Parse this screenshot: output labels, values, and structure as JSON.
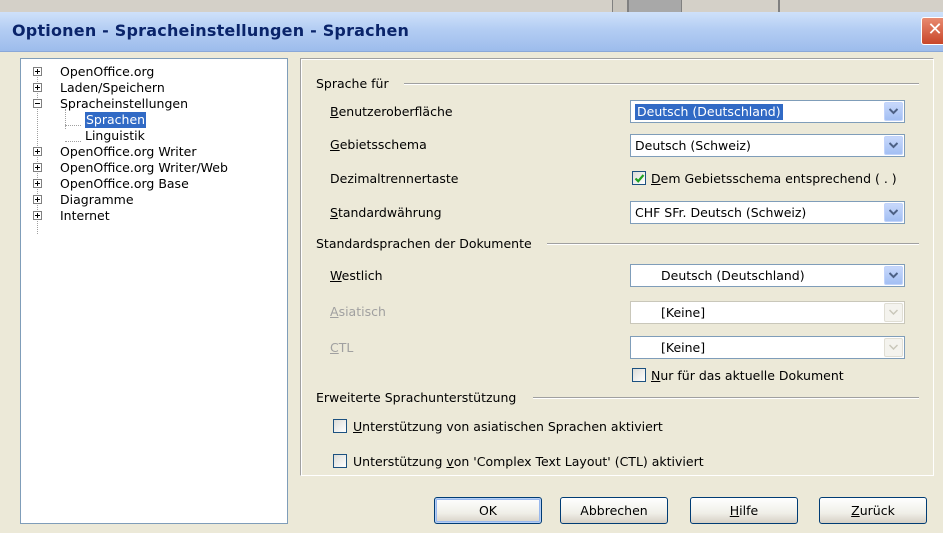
{
  "window": {
    "title": "Optionen - Spracheinstellungen - Sprachen",
    "close_glyph": "✕"
  },
  "tree": {
    "items": [
      {
        "label": "OpenOffice.org",
        "expander": "plus"
      },
      {
        "label": "Laden/Speichern",
        "expander": "plus"
      },
      {
        "label": "Spracheinstellungen",
        "expander": "minus"
      },
      {
        "label": "Sprachen",
        "selected": true,
        "child": true
      },
      {
        "label": "Linguistik",
        "child": true
      },
      {
        "label": "OpenOffice.org Writer",
        "expander": "plus"
      },
      {
        "label": "OpenOffice.org Writer/Web",
        "expander": "plus"
      },
      {
        "label": "OpenOffice.org Base",
        "expander": "plus"
      },
      {
        "label": "Diagramme",
        "expander": "plus"
      },
      {
        "label": "Internet",
        "expander": "plus"
      }
    ]
  },
  "language_for": {
    "section_label": "Sprache für",
    "ui_label_first": "B",
    "ui_label_rest": "enutzeroberfläche",
    "ui_value": "Deutsch (Deutschland)",
    "locale_label_first": "G",
    "locale_label_rest": "ebietsschema",
    "locale_value": "Deutsch (Schweiz)",
    "decimal_label": "Dezimaltrennertaste",
    "decimal_checkbox_first": "D",
    "decimal_checkbox_rest": "em Gebietsschema entsprechend ( . )",
    "decimal_checked": true,
    "currency_label_first": "S",
    "currency_label_rest": "tandardwährung",
    "currency_value": "CHF  SFr. Deutsch (Schweiz)"
  },
  "default_languages": {
    "section_label": "Standardsprachen der Dokumente",
    "western_label_first": "W",
    "western_label_rest": "estlich",
    "western_value": "Deutsch (Deutschland)",
    "asian_label_first": "A",
    "asian_label_rest": "siatisch",
    "asian_value": "[Keine]",
    "ctl_label_first": "C",
    "ctl_label_rest": "TL",
    "ctl_value": "[Keine]",
    "current_doc_first": "N",
    "current_doc_rest": "ur für das aktuelle Dokument",
    "current_doc_checked": false
  },
  "enhanced_support": {
    "section_label": "Erweiterte Sprachunterstützung",
    "asian_first": "U",
    "asian_rest": "nterstützung von asiatischen Sprachen aktiviert",
    "asian_checked": false,
    "ctl_pre": "Unterstützung ",
    "ctl_u": "v",
    "ctl_post": "on 'Complex Text Layout' (CTL) aktiviert",
    "ctl_checked": false
  },
  "buttons": {
    "ok": "OK",
    "cancel": "Abbrechen",
    "help_first": "H",
    "help_rest": "ilfe",
    "back_first": "Z",
    "back_rest": "urück"
  },
  "icons": {
    "dropdown": "chevron-down-icon",
    "check": "checkmark-icon",
    "expand": "plus-box-icon",
    "collapse": "minus-box-icon"
  },
  "colors": {
    "selection": "#316ac5",
    "title_text": "#0a246a",
    "dialog_bg": "#ece9d8",
    "border_blue": "#7f9db9"
  }
}
